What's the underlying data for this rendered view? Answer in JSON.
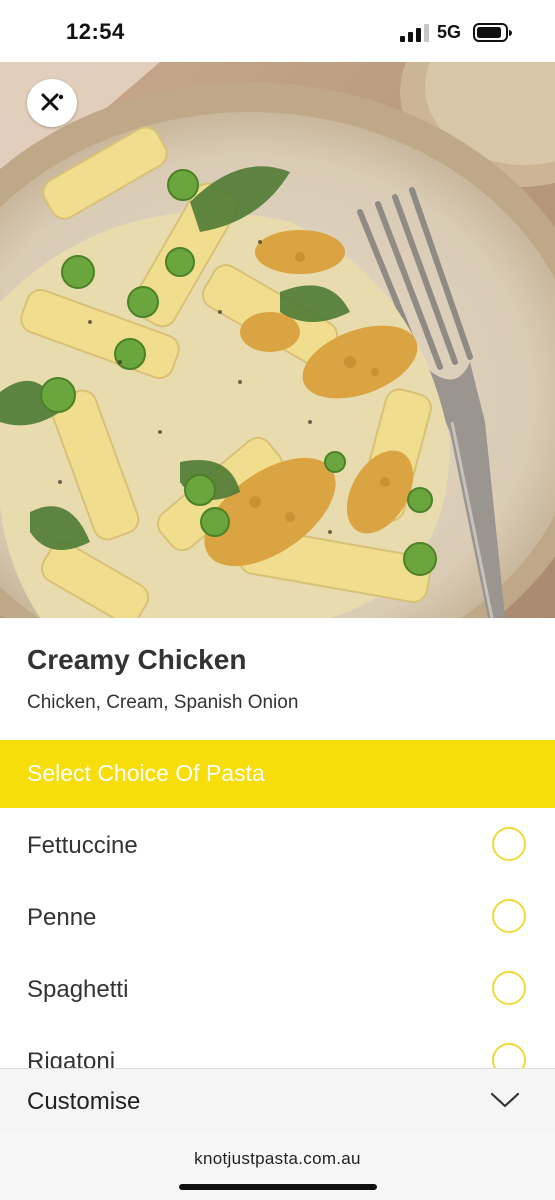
{
  "status": {
    "time": "12:54",
    "network": "5G"
  },
  "hero": {
    "image_alt": "Creamy chicken penne pasta with peas, spinach and toasted breadcrumbs on a ceramic plate with a fork"
  },
  "item": {
    "title": "Creamy Chicken",
    "description": "Chicken, Cream, Spanish Onion"
  },
  "pasta_section": {
    "title": "Select Choice Of Pasta",
    "accent_color": "#f7dd09",
    "options": [
      {
        "label": "Fettuccine",
        "selected": false
      },
      {
        "label": "Penne",
        "selected": false
      },
      {
        "label": "Spaghetti",
        "selected": false
      },
      {
        "label": "Rigatoni",
        "selected": false
      }
    ]
  },
  "customise": {
    "label": "Customise",
    "icon": "chevron-down-icon"
  },
  "browser": {
    "url": "knotjustpasta.com.au"
  }
}
